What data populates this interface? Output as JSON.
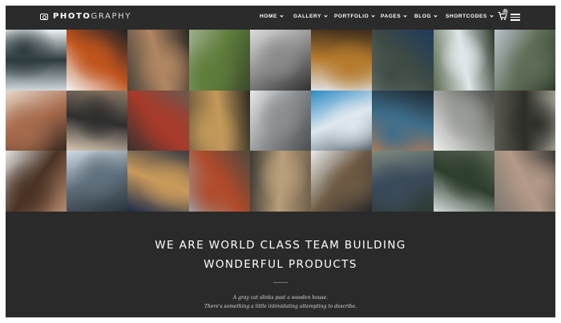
{
  "header": {
    "logo": {
      "icon": "camera-icon",
      "text_bold": "PHOTO",
      "text_light": "GRAPHY"
    },
    "nav": [
      {
        "label": "HOME",
        "has_dropdown": true
      },
      {
        "label": "GALLERY",
        "has_dropdown": true
      },
      {
        "label": "PORTFOLIO",
        "has_dropdown": true
      },
      {
        "label": "PAGES",
        "has_dropdown": true
      },
      {
        "label": "BLOG",
        "has_dropdown": true
      },
      {
        "label": "SHORTCODES",
        "has_dropdown": true
      }
    ],
    "cart": {
      "icon": "cart-icon",
      "count": "0"
    },
    "menu_icon": "hamburger-icon"
  },
  "gallery": {
    "tiles": [
      {
        "subject": "snowy lake cabin",
        "colors": [
          "#cfd8dc",
          "#2e3b3f",
          "#eef2f4"
        ]
      },
      {
        "subject": "autumn lake",
        "colors": [
          "#f4f4f4",
          "#c0541c",
          "#1f2226"
        ]
      },
      {
        "subject": "stacked logs",
        "colors": [
          "#4a443c",
          "#b08662",
          "#2b2723"
        ]
      },
      {
        "subject": "green field",
        "colors": [
          "#9fae8c",
          "#5e7c3b",
          "#3b4a2c"
        ]
      },
      {
        "subject": "woman in subway",
        "colors": [
          "#dcdcdc",
          "#8a8a8a",
          "#2f2f2f"
        ]
      },
      {
        "subject": "person in beanie",
        "colors": [
          "#e0e0e0",
          "#b57a2c",
          "#3a2a1a"
        ]
      },
      {
        "subject": "person in forest",
        "colors": [
          "#6c7a72",
          "#3e4a44",
          "#1f3b5c"
        ]
      },
      {
        "subject": "waterfall",
        "colors": [
          "#5c6b4e",
          "#dfe7ea",
          "#2c3526"
        ]
      },
      {
        "subject": "mountain valley",
        "colors": [
          "#b9c4cc",
          "#5f6e58",
          "#2f3a2c"
        ]
      },
      {
        "subject": "woman on phone",
        "colors": [
          "#e8d6c8",
          "#a66a4c",
          "#3a2a22"
        ]
      },
      {
        "subject": "hands with camera",
        "colors": [
          "#d9c6b0",
          "#2e2e2e",
          "#8a7866"
        ]
      },
      {
        "subject": "vintage camera",
        "colors": [
          "#3a3230",
          "#a83a2a",
          "#6a5a4e"
        ]
      },
      {
        "subject": "forest road",
        "colors": [
          "#6e5a3c",
          "#c49a5a",
          "#2c2a22"
        ]
      },
      {
        "subject": "snowy sheep",
        "colors": [
          "#e6e8ea",
          "#8a8e90",
          "#4a4e50"
        ]
      },
      {
        "subject": "blue mountains",
        "colors": [
          "#2a8ac4",
          "#dfe8ee",
          "#5a6670"
        ]
      },
      {
        "subject": "sunset lake",
        "colors": [
          "#c87c4c",
          "#3e6e8a",
          "#1e2a34"
        ]
      },
      {
        "subject": "skate park",
        "colors": [
          "#f0f0ee",
          "#9a9c98",
          "#4a4c48"
        ]
      },
      {
        "subject": "misty forest",
        "colors": [
          "#5a5a52",
          "#2e2e28",
          "#9a9a90"
        ]
      },
      {
        "subject": "woman portrait",
        "colors": [
          "#e4e4e4",
          "#4a3224",
          "#b88a6e"
        ]
      },
      {
        "subject": "burnt forest",
        "colors": [
          "#cfdce6",
          "#5e6e7a",
          "#2a343c"
        ]
      },
      {
        "subject": "arc de triomphe",
        "colors": [
          "#1a2a4a",
          "#c89a5a",
          "#3a3a44"
        ]
      },
      {
        "subject": "golden gate bridge",
        "colors": [
          "#9aa8ae",
          "#b04a2a",
          "#4e4a3e"
        ]
      },
      {
        "subject": "pine cones",
        "colors": [
          "#3e3a34",
          "#b89e7a",
          "#6e5e4a"
        ]
      },
      {
        "subject": "running woman",
        "colors": [
          "#e8ecee",
          "#6e5a44",
          "#2a2a2a"
        ]
      },
      {
        "subject": "person in woods",
        "colors": [
          "#7e8a80",
          "#3a4a5a",
          "#2e3a32"
        ]
      },
      {
        "subject": "road in forest",
        "colors": [
          "#d6dcdc",
          "#2e3e2c",
          "#5e6a5a"
        ]
      },
      {
        "subject": "hand on glass",
        "colors": [
          "#7e7870",
          "#b49a88",
          "#3e3a36"
        ]
      }
    ]
  },
  "hero": {
    "line1": "WE ARE WORLD CLASS TEAM BUILDING",
    "line2": "WONDERFUL PRODUCTS",
    "sub1": "A gray cat slinks past a wooden house.",
    "sub2": "There's something a little intimidating attempting to describe."
  }
}
